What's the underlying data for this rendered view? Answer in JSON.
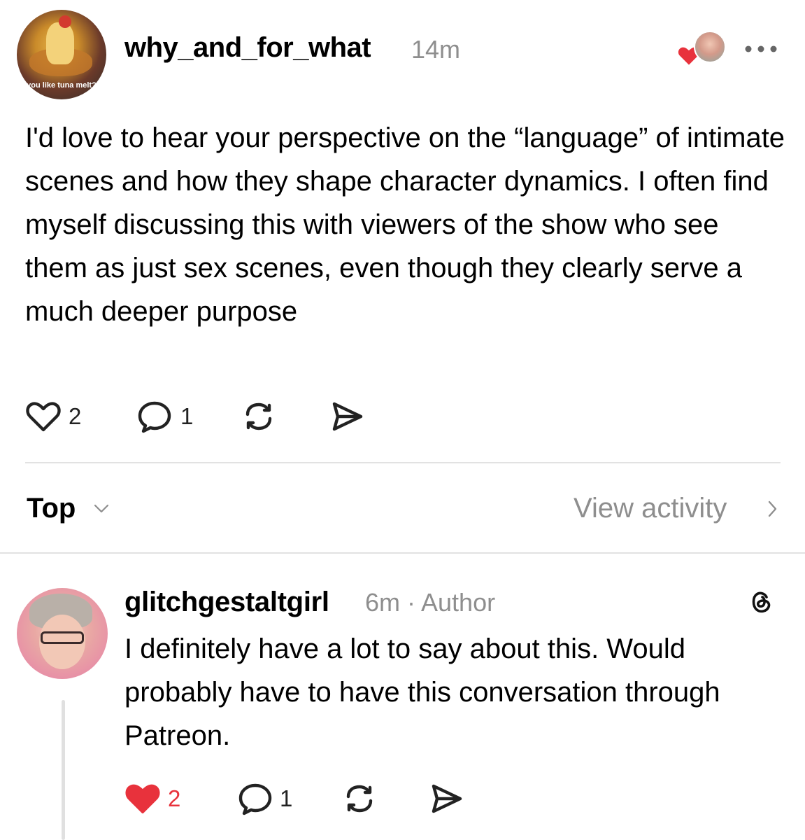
{
  "post": {
    "avatar_caption": "you like tuna melt?",
    "username": "why_and_for_what",
    "time": "14m",
    "body": "I'd love to hear your perspective on the “language” of intimate scenes and how they shape character dynamics. I often find myself discussing this with viewers of the show who see them as just sex scenes, even though they clearly serve a much deeper purpose",
    "actions": {
      "likes": "2",
      "replies": "1"
    },
    "liked_by_author_icon": "heart-icon",
    "heart_color": "#e8323c"
  },
  "sort": {
    "label": "Top"
  },
  "view_activity": {
    "label": "View activity"
  },
  "reply": {
    "username": "glitchgestaltgirl",
    "meta": "6m · Author",
    "body": "I definitely have a lot to say about this. Would probably have to have this conversation through Patreon.",
    "actions": {
      "likes": "2",
      "replies": "1",
      "liked": true
    }
  }
}
